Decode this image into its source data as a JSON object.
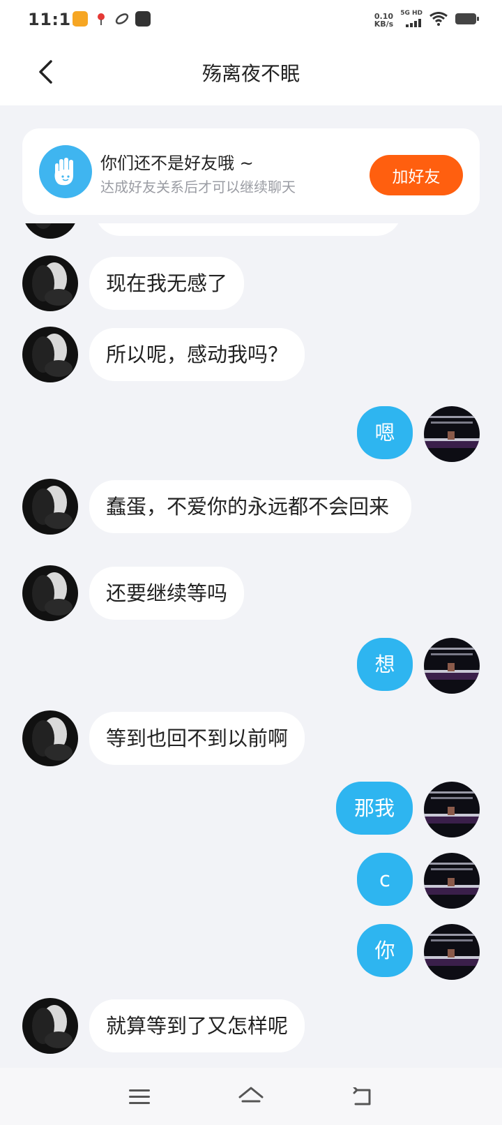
{
  "status_bar": {
    "time": "11:11",
    "net_speed_value": "0.10",
    "net_speed_unit": "KB/s",
    "network_label": "5G HD",
    "icons": [
      "video-app-icon",
      "location-app-icon",
      "link-app-icon",
      "bag-app-icon",
      "signal-icon",
      "wifi-icon",
      "battery-icon"
    ]
  },
  "header": {
    "title": "殇离夜不眠"
  },
  "friend_banner": {
    "title": "你们还不是好友哦 ~",
    "subtitle": "达成好友关系后才可以继续聊天",
    "button_label": "加好友"
  },
  "messages": [
    {
      "side": "in",
      "text": "现在我无感了"
    },
    {
      "side": "in",
      "text": "所以呢，感动我吗？"
    },
    {
      "side": "out",
      "text": "嗯"
    },
    {
      "side": "in",
      "text": "蠢蛋，不爱你的永远都不会回来"
    },
    {
      "side": "in",
      "text": "还要继续等吗"
    },
    {
      "side": "out",
      "text": "想"
    },
    {
      "side": "in",
      "text": "等到也回不到以前啊"
    },
    {
      "side": "out",
      "text": "那我"
    },
    {
      "side": "out",
      "text": "c"
    },
    {
      "side": "out",
      "text": "你"
    },
    {
      "side": "in",
      "text": "就算等到了又怎样呢"
    }
  ],
  "colors": {
    "accent": "#2eb5f0",
    "add_button": "#ff5f0f",
    "background": "#f2f3f7"
  }
}
